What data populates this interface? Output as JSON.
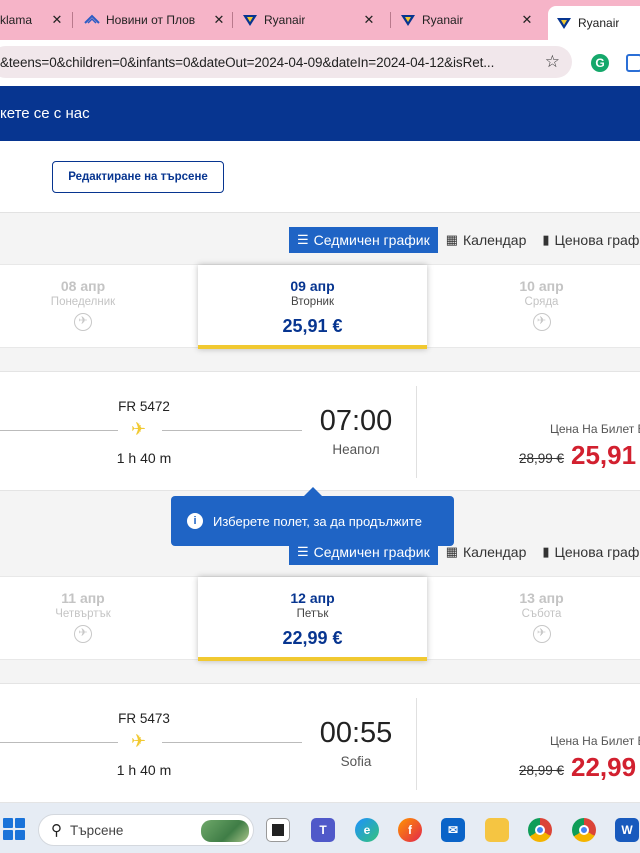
{
  "browser": {
    "tabs": [
      {
        "title": "klama",
        "favicon": "page-icon",
        "active": false
      },
      {
        "title": "Новини от Плов",
        "favicon": "news-icon",
        "active": false
      },
      {
        "title": "Ryanair",
        "favicon": "ryanair-icon",
        "active": false
      },
      {
        "title": "Ryanair",
        "favicon": "ryanair-icon",
        "active": false
      },
      {
        "title": "Ryanair",
        "favicon": "ryanair-icon",
        "active": true
      }
    ],
    "url": "&teens=0&children=0&infants=0&dateOut=2024-04-09&dateIn=2024-04-12&isRet...",
    "close_glyph": "✕"
  },
  "site": {
    "contact_link": "кете се с нас",
    "edit_search_label": "Редактиране на търсене",
    "view_tabs": {
      "weekly": "Седмичен график",
      "calendar": "Календар",
      "price": "Ценова граф"
    }
  },
  "outbound": {
    "dates": [
      {
        "date": "08 апр",
        "day": "Понеделник",
        "price": null
      },
      {
        "date": "09 апр",
        "day": "Вторник",
        "price": "25,91 €"
      },
      {
        "date": "10 апр",
        "day": "Сряда",
        "price": null
      }
    ],
    "flight": {
      "number": "FR 5472",
      "duration": "1 h 40 m",
      "departure_time": "07:00",
      "destination": "Неапол",
      "fare_label": "Цена На Билет Е",
      "old_price": "28,99 €",
      "price": "25,91"
    }
  },
  "tooltip": {
    "text": "Изберете полет, за да продължите"
  },
  "inbound": {
    "dates": [
      {
        "date": "11 апр",
        "day": "Четвъртък",
        "price": null
      },
      {
        "date": "12 апр",
        "day": "Петък",
        "price": "22,99 €"
      },
      {
        "date": "13 апр",
        "day": "Събота",
        "price": null
      }
    ],
    "flight": {
      "number": "FR 5473",
      "duration": "1 h 40 m",
      "departure_time": "00:55",
      "destination": "Sofia",
      "fare_label": "Цена На Билет Е",
      "old_price": "28,99 €",
      "price": "22,99"
    }
  },
  "taskbar": {
    "search_placeholder": "Търсене",
    "apps": [
      "task-view-icon",
      "teams-icon",
      "edge-icon",
      "firefox-icon",
      "mail-icon",
      "file-explorer-icon",
      "chrome-icon",
      "chrome-profile-icon",
      "word-icon"
    ]
  },
  "colors": {
    "ryanair_blue": "#073590",
    "accent_blue": "#1f64c5",
    "yellow": "#f1c931",
    "price_red": "#d2202f",
    "tabstrip_pink": "#f6b4c8"
  }
}
